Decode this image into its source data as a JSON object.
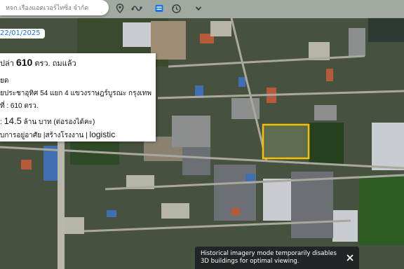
{
  "search": {
    "text": "หจก.เรืองแอดเวอร์ไทซิ่ง จำกัด"
  },
  "toolbar_icons": [
    "location-pin-icon",
    "route-icon",
    "street-view-icon",
    "history-icon",
    "chevron-down-icon"
  ],
  "imagery": {
    "date": "22/01/2025"
  },
  "listing": {
    "line1_pre": "ปล่า ",
    "line1_area": "610",
    "line1_post": " ตรว. ถมแล้ว",
    "line2": "ยด",
    "line3": "ยประชาอุทิศ 54 แยก 4 แขวงราษฎร์บูรณะ กรุงเทพ",
    "line4": "ที่ : 610 ตรว.",
    "line5_pre": ": ",
    "line5_price": "14.5",
    "line5_post": " ล้าน บาท (ต่อรองได้คะ)",
    "line6_pre": "บการอยู่อาศัย |สร้างโรงงาน | ",
    "line6_tag": "logistic"
  },
  "toast": {
    "message": "Historical imagery mode temporarily disables 3D buildings for optimal viewing."
  },
  "colors": {
    "highlight": "#f2c200",
    "date_text": "#1a73e8",
    "toolbar_icon": "#3c4043"
  }
}
